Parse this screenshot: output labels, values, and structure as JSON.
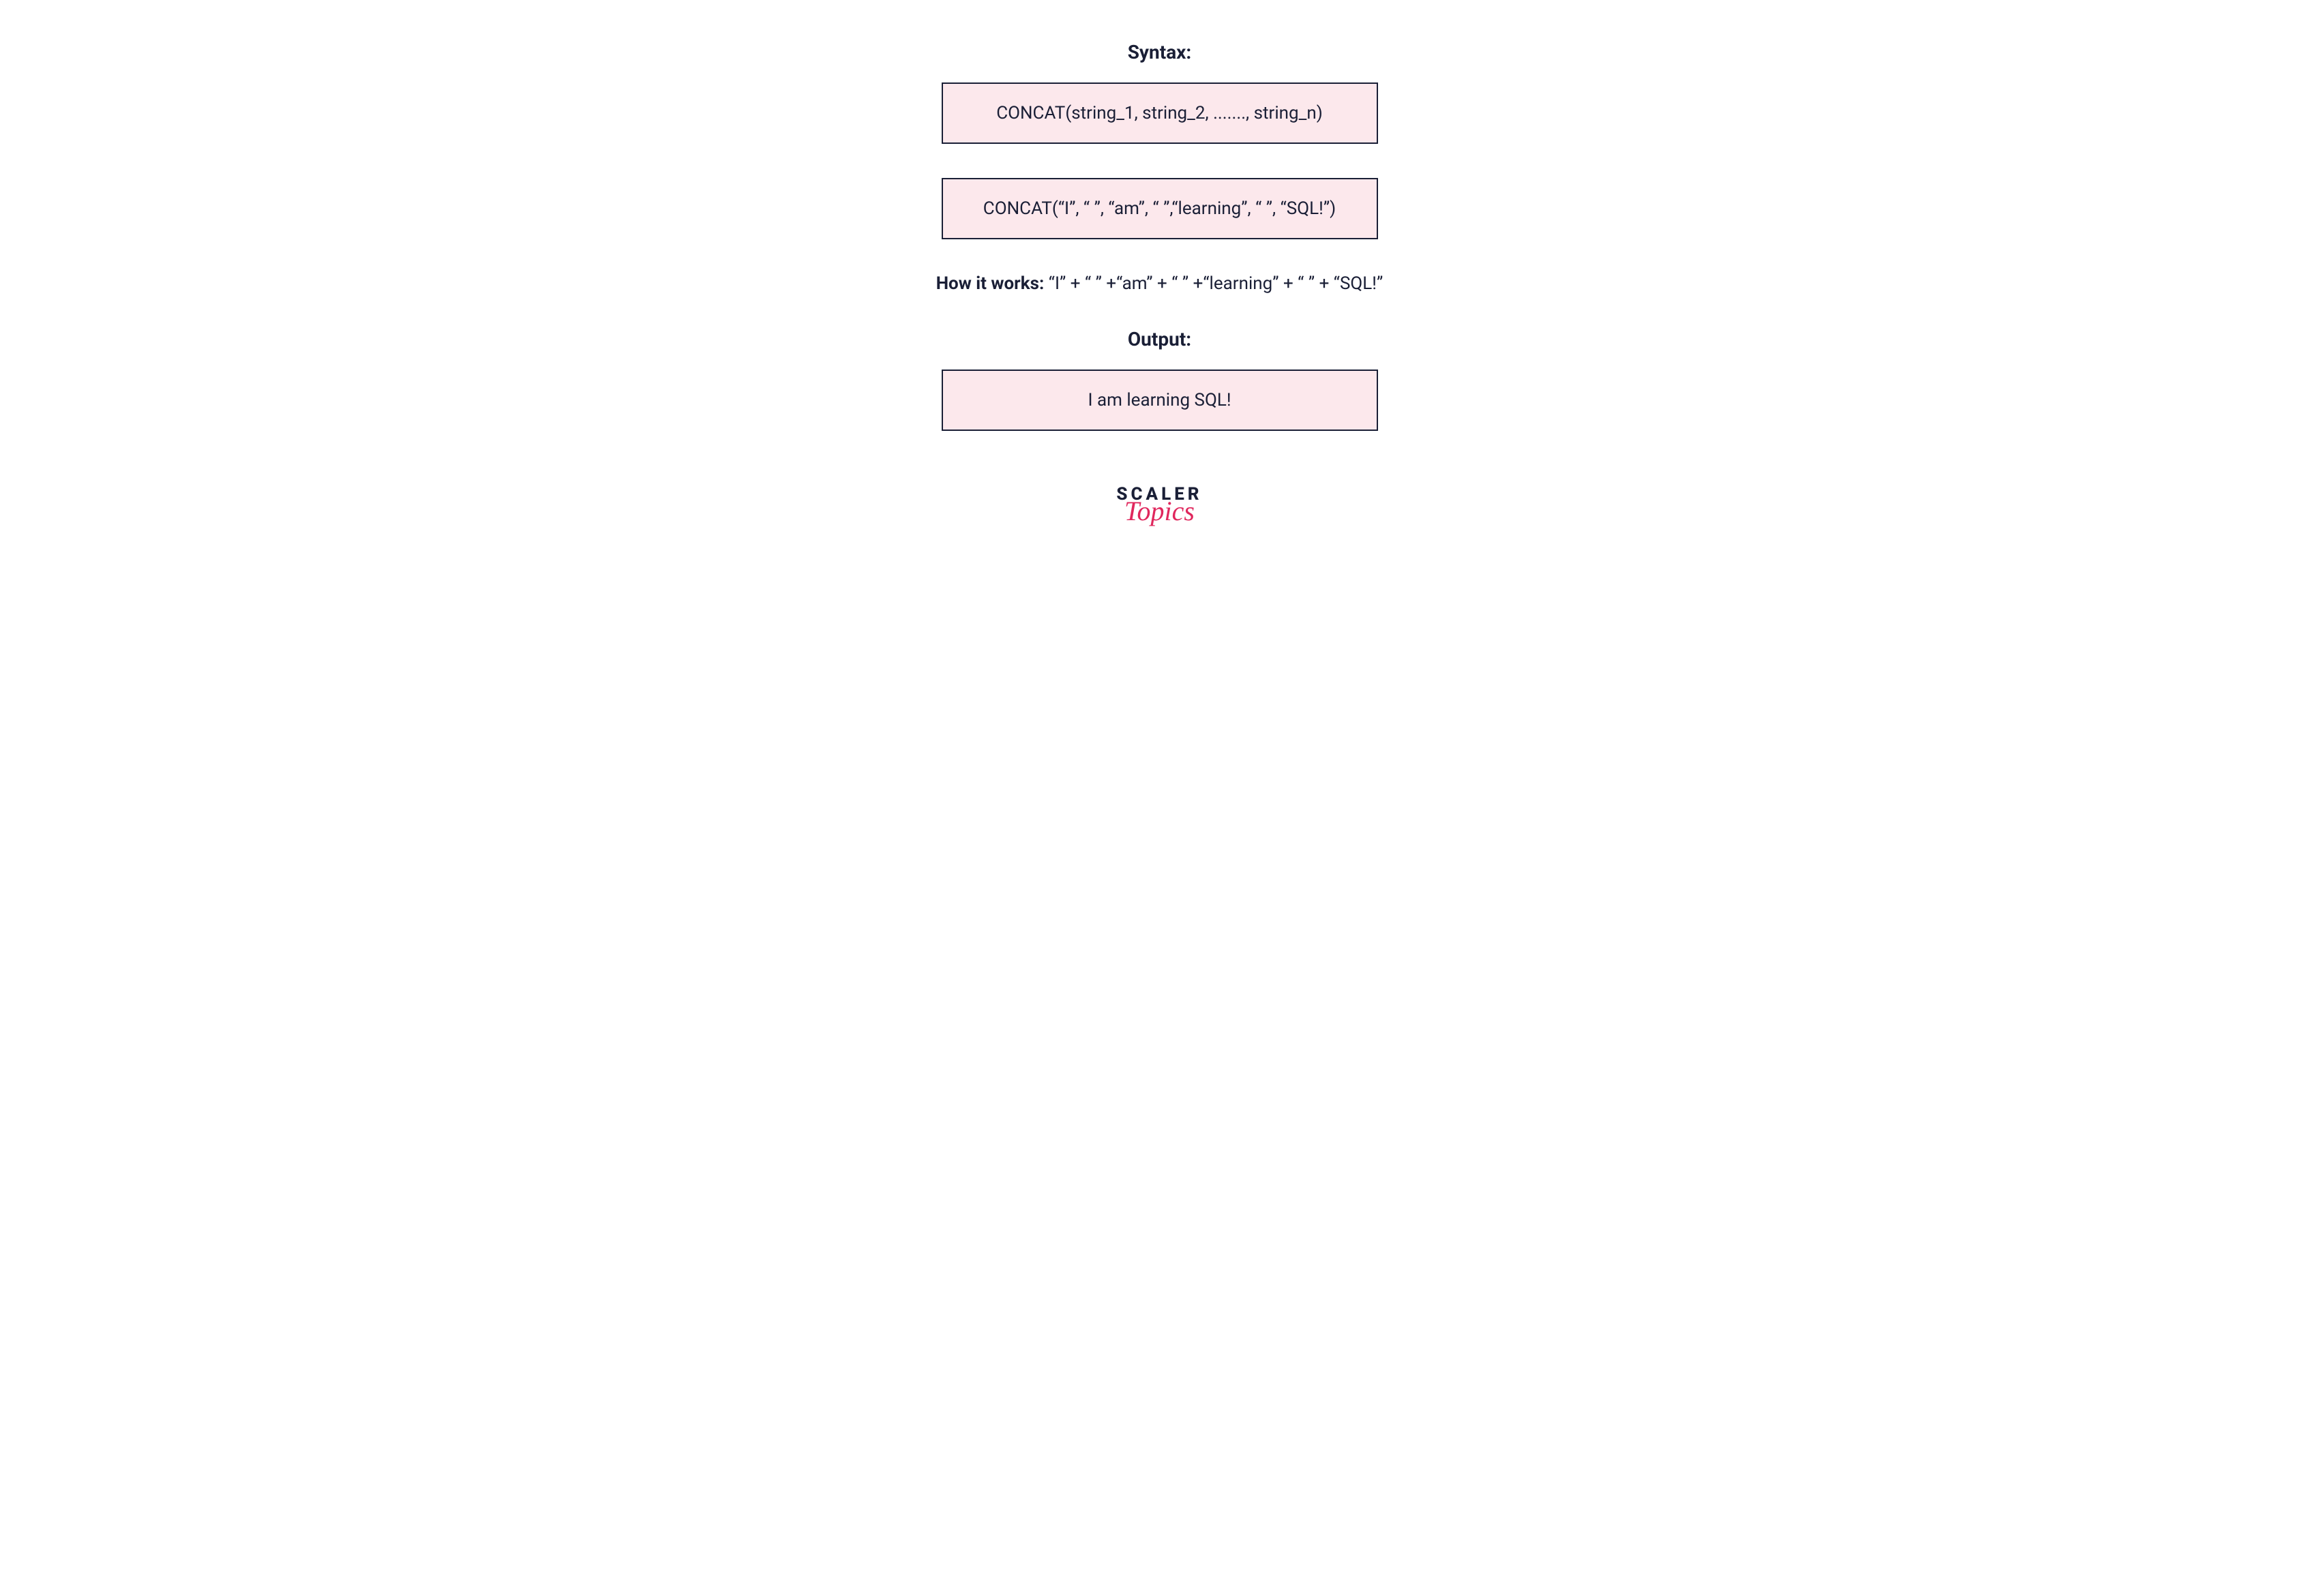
{
  "headings": {
    "syntax": "Syntax:",
    "output": "Output:"
  },
  "boxes": {
    "syntax": "CONCAT(string_1, string_2, ......., string_n)",
    "example": "CONCAT(“I”, “ ”, “am”, “ ”,“learning”, “ ”, “SQL!”)",
    "output": "I am learning SQL!"
  },
  "how_it_works": {
    "label": "How it works: ",
    "text": "“I” + “ ” +“am” + “ ” +“learning” + “ ” + “SQL!”"
  },
  "logo": {
    "line1": "SCALER",
    "line2": "Topics"
  }
}
